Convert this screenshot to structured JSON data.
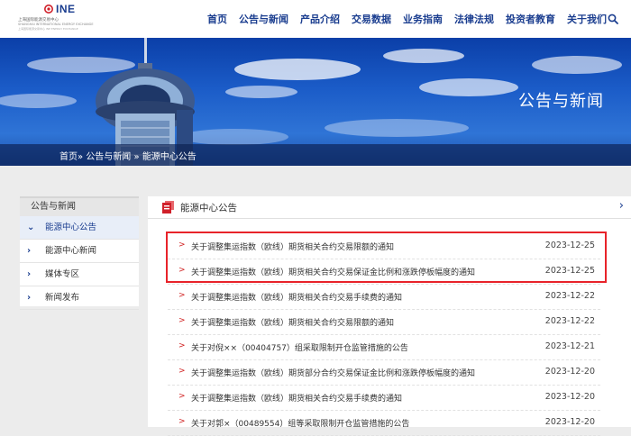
{
  "header": {
    "logo_text": "INE",
    "logo_sub": "上海国际能源交易中心",
    "logo_sub2": "SHANGHAI INTERNATIONAL ENERGY EXCHANGE",
    "logo_sub3": "上海国际能源交易中心 INE ENERGY EXCHANGE",
    "nav": [
      "首页",
      "公告与新闻",
      "产品介绍",
      "交易数据",
      "业务指南",
      "法律法规",
      "投资者教育",
      "关于我们"
    ],
    "search_icon": "search-icon"
  },
  "banner": {
    "title": "公告与新闻"
  },
  "breadcrumb": {
    "home": "首页»",
    "section": "公告与新闻",
    "sep": "»",
    "current": "能源中心公告"
  },
  "sidebar": {
    "title": "公告与新闻",
    "items": [
      {
        "label": "能源中心公告",
        "chevron": "⌄",
        "active": true
      },
      {
        "label": "能源中心新闻",
        "chevron": "›",
        "active": false
      },
      {
        "label": "媒体专区",
        "chevron": "›",
        "active": false
      },
      {
        "label": "新闻发布",
        "chevron": "›",
        "active": false
      }
    ]
  },
  "main": {
    "title": "能源中心公告",
    "chevron": "›",
    "bullet": ">",
    "rows": [
      {
        "title": "关于调整集运指数（欧线）期货相关合约交易限额的通知",
        "date": "2023-12-25"
      },
      {
        "title": "关于调整集运指数（欧线）期货相关合约交易保证金比例和涨跌停板幅度的通知",
        "date": "2023-12-25"
      },
      {
        "title": "关于调整集运指数（欧线）期货相关合约交易手续费的通知",
        "date": "2023-12-22"
      },
      {
        "title": "关于调整集运指数（欧线）期货相关合约交易限额的通知",
        "date": "2023-12-22"
      },
      {
        "title": "关于对倪××（00404757）组采取限制开仓监管措施的公告",
        "date": "2023-12-21"
      },
      {
        "title": "关于调整集运指数（欧线）期货部分合约交易保证金比例和涨跌停板幅度的通知",
        "date": "2023-12-20"
      },
      {
        "title": "关于调整集运指数（欧线）期货相关合约交易手续费的通知",
        "date": "2023-12-20"
      },
      {
        "title": "关于对郭×（00489554）组等采取限制开仓监管措施的公告",
        "date": "2023-12-20"
      }
    ]
  },
  "colors": {
    "brand_blue": "#1a3d8f",
    "highlight_red": "#e8232a"
  }
}
